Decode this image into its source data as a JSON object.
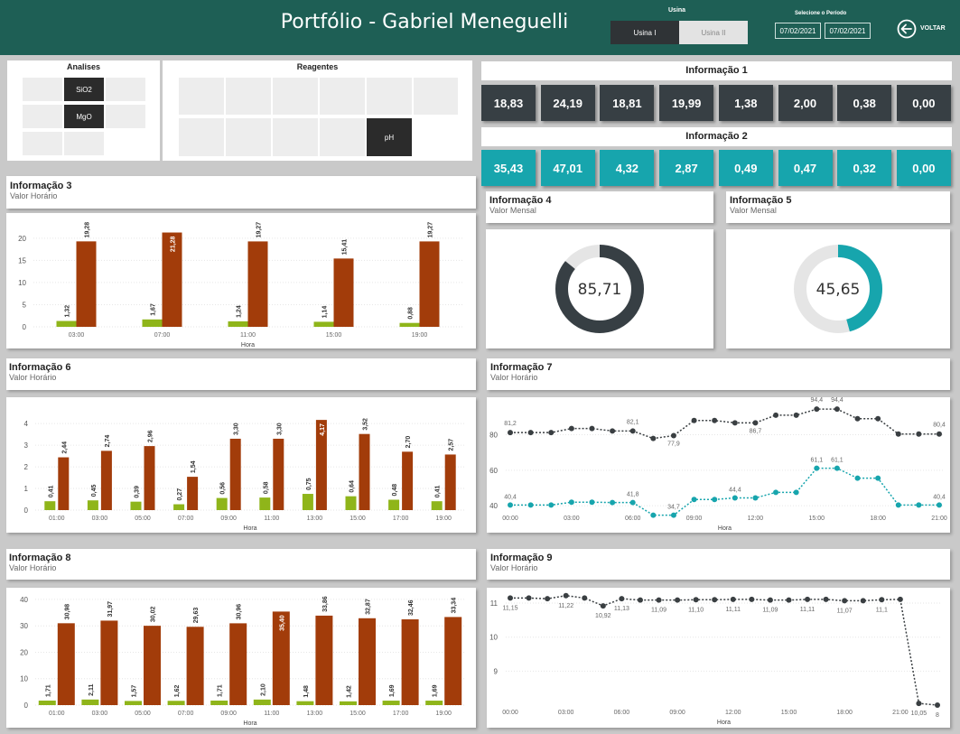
{
  "header": {
    "title": "Portfólio - Gabriel Meneguelli",
    "usina_label": "Usina",
    "usina_options": [
      "Usina I",
      "Usina II"
    ],
    "period_label": "Selecione o Período",
    "date_start": "07/02/2021",
    "date_end": "07/02/2021",
    "back_label": "VOLTAR"
  },
  "colors": {
    "header": "#1e5f55",
    "dark": "#373f44",
    "teal": "#17a5ad",
    "green": "#8fb51a",
    "rust": "#a23c0a"
  },
  "analises": {
    "title": "Analises",
    "chips": [
      "",
      "SiO2",
      "",
      "",
      "MgO",
      "",
      "",
      ""
    ]
  },
  "reagentes": {
    "title": "Reagentes",
    "chips": [
      "",
      "",
      "",
      "",
      "",
      "",
      "",
      "",
      "",
      "",
      "pH"
    ]
  },
  "info1": {
    "title": "Informação 1",
    "values": [
      "18,83",
      "24,19",
      "18,81",
      "19,99",
      "1,38",
      "2,00",
      "0,38",
      "0,00"
    ]
  },
  "info2": {
    "title": "Informação 2",
    "values": [
      "35,43",
      "47,01",
      "4,32",
      "2,87",
      "0,49",
      "0,47",
      "0,32",
      "0,00"
    ]
  },
  "info3": {
    "title": "Informação 3",
    "subtitle": "Valor Horário"
  },
  "info4": {
    "title": "Informação 4",
    "subtitle": "Valor Mensal",
    "value_label": "85,71"
  },
  "info5": {
    "title": "Informação 5",
    "subtitle": "Valor Mensal",
    "value_label": "45,65"
  },
  "info6": {
    "title": "Informação 6",
    "subtitle": "Valor Horário"
  },
  "info7": {
    "title": "Informação 7",
    "subtitle": "Valor Horário"
  },
  "info8": {
    "title": "Informação 8",
    "subtitle": "Valor Horário"
  },
  "info9": {
    "title": "Informação 9",
    "subtitle": "Valor Horário"
  },
  "chart_data": [
    {
      "id": "info3",
      "type": "bar",
      "xlabel": "Hora",
      "ylim": [
        0,
        22
      ],
      "yticks": [
        0,
        5,
        10,
        15,
        20
      ],
      "categories": [
        "03:00",
        "07:00",
        "11:00",
        "15:00",
        "19:00"
      ],
      "series": [
        {
          "values": [
            1.32,
            1.67,
            1.24,
            1.14,
            0.88
          ],
          "labels": [
            "1,32",
            "1,67",
            "1,24",
            "1,14",
            "0,88"
          ]
        },
        {
          "values": [
            19.28,
            21.28,
            19.27,
            15.41,
            19.27
          ],
          "labels": [
            "19,28",
            "21,28",
            "19,27",
            "15,41",
            "19,27"
          ]
        }
      ]
    },
    {
      "id": "info4",
      "type": "pie",
      "values": [
        85.71,
        14.29
      ],
      "label": "85,71"
    },
    {
      "id": "info5",
      "type": "pie",
      "values": [
        45.65,
        54.35
      ],
      "label": "45,65"
    },
    {
      "id": "info6",
      "type": "bar",
      "xlabel": "Hora",
      "ylim": [
        0,
        4.3
      ],
      "yticks": [
        0,
        1,
        2,
        3,
        4
      ],
      "categories": [
        "01:00",
        "03:00",
        "05:00",
        "07:00",
        "09:00",
        "11:00",
        "13:00",
        "15:00",
        "17:00",
        "19:00"
      ],
      "series": [
        {
          "values": [
            0.41,
            0.45,
            0.39,
            0.27,
            0.56,
            0.58,
            0.75,
            0.64,
            0.48,
            0.41
          ],
          "labels": [
            "0,41",
            "0,45",
            "0,39",
            "0,27",
            "0,56",
            "0,58",
            "0,75",
            "0,64",
            "0,48",
            "0,41"
          ]
        },
        {
          "values": [
            2.44,
            2.74,
            2.96,
            1.54,
            3.3,
            3.3,
            4.17,
            3.52,
            2.7,
            2.57
          ],
          "labels": [
            "2,44",
            "2,74",
            "2,96",
            "1,54",
            "3,30",
            "3,30",
            "4,17",
            "3,52",
            "2,70",
            "2,57"
          ]
        }
      ]
    },
    {
      "id": "info7",
      "type": "line",
      "xlabel": "Hora",
      "ylim": [
        35,
        95
      ],
      "yticks": [
        40,
        60,
        80
      ],
      "x": [
        "00:00",
        "01:00",
        "02:00",
        "03:00",
        "04:00",
        "05:00",
        "06:00",
        "07:00",
        "08:00",
        "09:00",
        "10:00",
        "11:00",
        "12:00",
        "13:00",
        "14:00",
        "15:00",
        "16:00",
        "17:00",
        "18:00",
        "19:00",
        "20:00",
        "21:00"
      ],
      "xticks": [
        "00:00",
        "03:00",
        "06:00",
        "09:00",
        "12:00",
        "15:00",
        "18:00",
        "21:00"
      ],
      "series": [
        {
          "values": [
            81.2,
            81.2,
            81.2,
            83.5,
            83.5,
            82.1,
            82.1,
            77.9,
            79.5,
            88.0,
            88.0,
            86.7,
            86.7,
            91.0,
            91.0,
            94.4,
            94.4,
            89.0,
            89.0,
            80.4,
            80.4,
            80.4
          ],
          "labels": [
            "81,2",
            "",
            "",
            "",
            "",
            "",
            "82,1",
            "",
            "77,9",
            "",
            "",
            "",
            "86,7",
            "",
            "",
            "94,4",
            "94,4",
            "",
            "",
            "",
            "",
            "80,4"
          ]
        },
        {
          "values": [
            40.4,
            40.4,
            40.4,
            42.0,
            42.0,
            41.8,
            41.8,
            34.7,
            34.7,
            43.5,
            43.5,
            44.4,
            44.4,
            47.5,
            47.5,
            61.1,
            61.1,
            55.5,
            55.5,
            40.4,
            40.4,
            40.4
          ],
          "labels": [
            "40,4",
            "",
            "",
            "",
            "",
            "",
            "41,8",
            "",
            "34,7",
            "",
            "",
            "44,4",
            "",
            "",
            "",
            "61,1",
            "61,1",
            "",
            "",
            "",
            "",
            "40,4"
          ]
        }
      ]
    },
    {
      "id": "info8",
      "type": "bar",
      "xlabel": "Hora",
      "ylim": [
        0,
        41
      ],
      "yticks": [
        0,
        10,
        20,
        30,
        40
      ],
      "categories": [
        "01:00",
        "03:00",
        "05:00",
        "07:00",
        "09:00",
        "11:00",
        "13:00",
        "15:00",
        "17:00",
        "19:00"
      ],
      "series": [
        {
          "values": [
            1.71,
            2.11,
            1.57,
            1.62,
            1.71,
            2.1,
            1.48,
            1.42,
            1.69,
            1.69
          ],
          "labels": [
            "1,71",
            "2,11",
            "1,57",
            "1,62",
            "1,71",
            "2,10",
            "1,48",
            "1,42",
            "1,69",
            "1,69"
          ]
        },
        {
          "values": [
            30.98,
            31.97,
            30.02,
            29.63,
            30.96,
            35.4,
            33.86,
            32.87,
            32.46,
            33.34
          ],
          "labels": [
            "30,98",
            "31,97",
            "30,02",
            "29,63",
            "30,96",
            "35,40",
            "33,86",
            "32,87",
            "32,46",
            "33,34"
          ]
        }
      ]
    },
    {
      "id": "info9",
      "type": "line",
      "xlabel": "Hora",
      "ylim": [
        8,
        11.4
      ],
      "yticks": [
        9,
        10,
        11
      ],
      "x": [
        "00:00",
        "01:00",
        "02:00",
        "03:00",
        "04:00",
        "05:00",
        "06:00",
        "07:00",
        "08:00",
        "09:00",
        "10:00",
        "11:00",
        "12:00",
        "13:00",
        "14:00",
        "15:00",
        "16:00",
        "17:00",
        "18:00",
        "19:00",
        "20:00",
        "21:00",
        "22:00",
        "23:00"
      ],
      "xticks": [
        "00:00",
        "03:00",
        "06:00",
        "09:00",
        "12:00",
        "15:00",
        "18:00",
        "21:00"
      ],
      "series": [
        {
          "values": [
            11.15,
            11.15,
            11.13,
            11.22,
            11.15,
            10.92,
            11.13,
            11.09,
            11.09,
            11.09,
            11.1,
            11.1,
            11.11,
            11.11,
            11.09,
            11.09,
            11.11,
            11.11,
            11.07,
            11.07,
            11.1,
            11.11,
            8.05,
            8.0
          ],
          "labels": [
            "11,15",
            "",
            "",
            "11,22",
            "",
            "10,92",
            "11,13",
            "",
            "11,09",
            "",
            "11,10",
            "",
            "11,11",
            "",
            "11,09",
            "",
            "11,11",
            "",
            "11,07",
            "",
            "11,1",
            "",
            "10,05",
            "8"
          ]
        }
      ]
    }
  ]
}
